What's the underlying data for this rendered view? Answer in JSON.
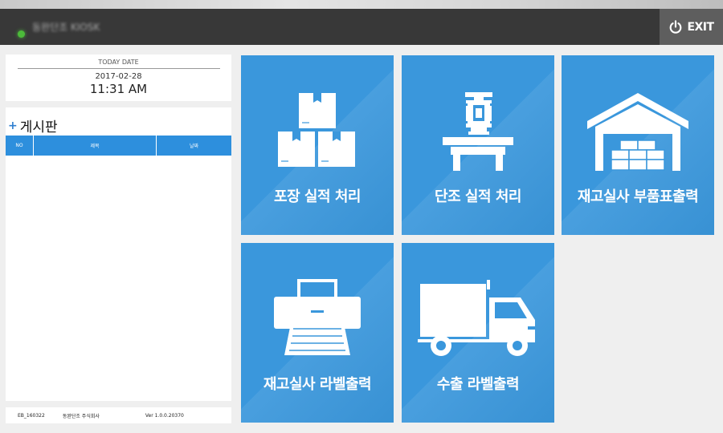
{
  "window": {
    "title": "동완단조 KIOSK",
    "exit_label": "EXIT"
  },
  "today": {
    "heading": "TODAY DATE",
    "date": "2017-02-28",
    "time": "11:31 AM"
  },
  "board": {
    "title": "게시판",
    "columns": [
      "NO",
      "제목",
      "날짜"
    ],
    "rows": []
  },
  "footer": {
    "code": "EB_160322",
    "company": "동완단조 주식회사",
    "version": "Ver 1.0.0.20370"
  },
  "tiles": [
    {
      "label": "포장 실적 처리",
      "icon": "boxes-icon"
    },
    {
      "label": "단조 실적 처리",
      "icon": "forging-press-icon"
    },
    {
      "label": "재고실사 부품표출력",
      "icon": "warehouse-icon"
    },
    {
      "label": "재고실사 라벨출력",
      "icon": "printer-icon"
    },
    {
      "label": "수출 라벨출력",
      "icon": "truck-icon"
    }
  ],
  "colors": {
    "tile": "#3a97dc",
    "titlebar": "#383838",
    "exit": "#5e5e5e",
    "board_header": "#2d8fdd"
  }
}
